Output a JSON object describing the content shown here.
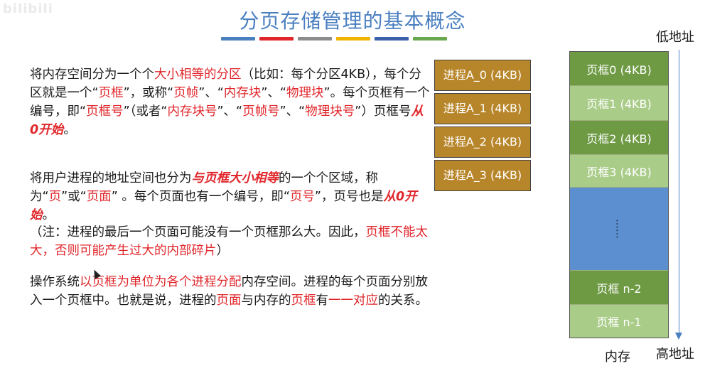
{
  "watermark": "bilibili",
  "title": "分页存储管理的基本概念",
  "title_bar_colors": [
    "#4a7fc0",
    "#e0262b",
    "#8c8c8c",
    "#f0b400",
    "#3b5fa8",
    "#6aa84f"
  ],
  "para1": {
    "s1": "将内存空间分为一个个",
    "s2": "大小相等的分区",
    "s3": "（比如：每个分区4KB），每个分区就是一个“",
    "s4": "页框",
    "s5": "”，或称“",
    "s6": "页帧",
    "s7": "”、“",
    "s8": "内存块",
    "s9": "”、“",
    "s10": "物理块",
    "s11": "”。每个页框有一个编号，即“",
    "s12": "页框号",
    "s13": "”（或者“",
    "s14": "内存块号",
    "s15": "”、“",
    "s16": "页帧号",
    "s17": "”、“",
    "s18": "物理块号",
    "s19": "”）页框号",
    "s20": "从0开始",
    "s21": "。"
  },
  "para2": {
    "s1": "将用户进程的地址空间也分为",
    "s2": "与页框大小相等",
    "s3": "的一个个区域，称为“",
    "s4": "页",
    "s5": "”或“",
    "s6": "页面",
    "s7": "” 。每个页面也有一个编号，即“",
    "s8": "页号",
    "s9": "”，页号也是",
    "s10": "从0开始",
    "s11": "。"
  },
  "para3": {
    "s1": "（注：进程的最后一个页面可能没有一个页框那么大。因此，",
    "s2": "页框不能太大，否则可能产生过大的内部碎片",
    "s3": "）"
  },
  "para4": {
    "s1": "操作系统",
    "s2": "以页框为单位为各个进程分配",
    "s3": "内存空间。进程的每个页面分别放入一个页框中。也就是说，进程的",
    "s4": "页面",
    "s5": "与内存的",
    "s6": "页框",
    "s7": "有",
    "s8": "一一对应",
    "s9": "的关系。"
  },
  "process_pages": [
    "进程A_0 (4KB)",
    "进程A_1 (4KB)",
    "进程A_2 (4KB)",
    "进程A_3 (4KB)"
  ],
  "memory": {
    "frames": [
      {
        "label": "页框0 (4KB)",
        "color": "#6e9a44"
      },
      {
        "label": "页框1 (4KB)",
        "color": "#a9cc88"
      },
      {
        "label": "页框2 (4KB)",
        "color": "#6e9a44"
      },
      {
        "label": "页框3 (4KB)",
        "color": "#a9cc88"
      },
      {
        "label": "……",
        "color": "#5b8fd0"
      },
      {
        "label": "页框 n-2",
        "color": "#6e9a44"
      },
      {
        "label": "页框 n-1",
        "color": "#a9cc88"
      }
    ],
    "label": "内存",
    "low_addr": "低地址",
    "high_addr": "高地址"
  }
}
